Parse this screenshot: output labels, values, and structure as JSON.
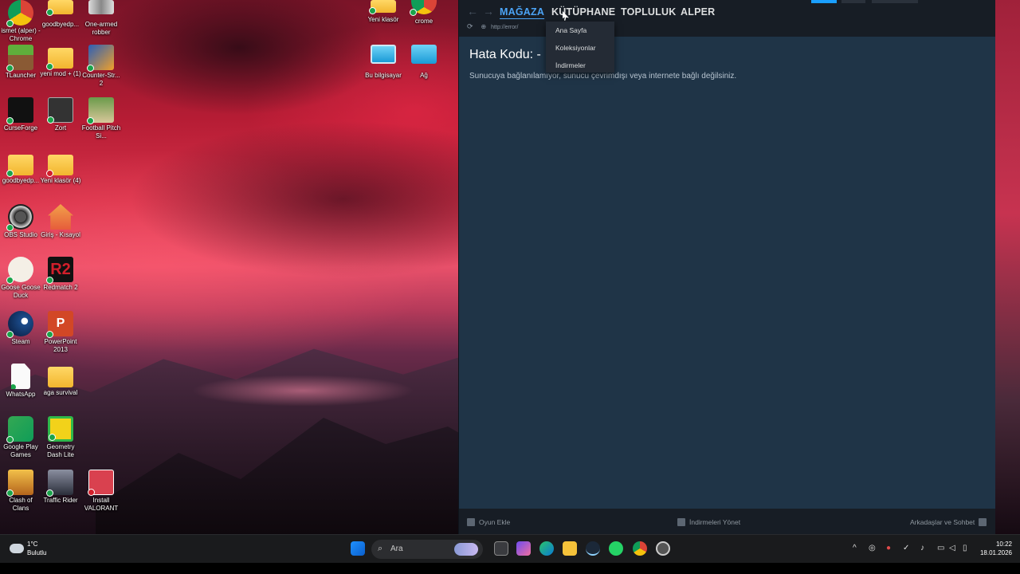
{
  "desktop_icons": [
    {
      "label": "ismet (alper) - Chrome",
      "icon": "chrome-icon",
      "badge": "ok"
    },
    {
      "label": "goodbyedp...",
      "icon": "folder-icon",
      "badge": "ok"
    },
    {
      "label": "One-armed robber",
      "icon": "game-icon",
      "badge": "none"
    },
    {
      "label": "TLauncher",
      "icon": "minecraft-icon",
      "badge": "ok"
    },
    {
      "label": "yeni mod + (1)",
      "icon": "folder-icon",
      "badge": "ok"
    },
    {
      "label": "Counter-Str... 2",
      "icon": "counter-strike-icon",
      "badge": "ok"
    },
    {
      "label": "CurseForge",
      "icon": "curseforge-icon",
      "badge": "ok"
    },
    {
      "label": "Zort",
      "icon": "zort-icon",
      "badge": "ok"
    },
    {
      "label": "Football Pitch Si...",
      "icon": "football-icon",
      "badge": "ok"
    },
    {
      "label": "goodbyedp...",
      "icon": "folder-icon",
      "badge": "ok"
    },
    {
      "label": "Yeni klasör (4)",
      "icon": "folder-icon",
      "badge": "err"
    },
    {
      "label": "OBS Studio",
      "icon": "obs-icon",
      "badge": "ok"
    },
    {
      "label": "Giriş - Kısayol",
      "icon": "home-icon",
      "badge": "ok"
    },
    {
      "label": "Goose Goose Duck",
      "icon": "goose-icon",
      "badge": "ok"
    },
    {
      "label": "Redmatch 2",
      "icon": "redmatch-icon",
      "badge": "ok"
    },
    {
      "label": "Steam",
      "icon": "steam-icon",
      "badge": "ok"
    },
    {
      "label": "PowerPoint 2013",
      "icon": "powerpoint-icon",
      "badge": "ok"
    },
    {
      "label": "WhatsApp",
      "icon": "file-icon",
      "badge": "ok"
    },
    {
      "label": "aga survival",
      "icon": "folder-icon",
      "badge": "none"
    },
    {
      "label": "Google Play Games",
      "icon": "google-play-games-icon",
      "badge": "ok"
    },
    {
      "label": "Geometry Dash Lite",
      "icon": "geometry-dash-icon",
      "badge": "ok"
    },
    {
      "label": "Clash of Clans",
      "icon": "clash-icon",
      "badge": "ok"
    },
    {
      "label": "Traffic Rider",
      "icon": "traffic-rider-icon",
      "badge": "ok"
    },
    {
      "label": "Install VALORANT",
      "icon": "valorant-icon",
      "badge": "err"
    },
    {
      "label": "Yeni klasör",
      "icon": "folder-icon",
      "badge": "ok"
    },
    {
      "label": "crome",
      "icon": "chrome-icon",
      "badge": "ok"
    },
    {
      "label": "Bu bilgisayar",
      "icon": "computer-icon",
      "badge": "none"
    },
    {
      "label": "Ağ",
      "icon": "network-icon",
      "badge": "none"
    }
  ],
  "steam": {
    "tabs": [
      "MAĞAZA",
      "KÜTÜPHANE",
      "TOPLULUK",
      "ALPER"
    ],
    "url": "http://error/",
    "error_title": "Hata Kodu: -",
    "error_message": "Sunucuya bağlanılamıyor, sunucu çevrimdışı veya internete bağlı değilsiniz.",
    "library_menu": [
      "Ana Sayfa",
      "Koleksiyonlar",
      "İndirmeler"
    ],
    "bottom": {
      "add_game": "Oyun Ekle",
      "manage_downloads": "İndirmeleri Yönet",
      "friends_chat": "Arkadaşlar ve Sohbet"
    },
    "accent": "#4ba3f5"
  },
  "taskbar": {
    "weather_temp": "1°C",
    "weather_desc": "Bulutlu",
    "search_placeholder": "Ara",
    "time": "10:22",
    "date": "18.01.2026"
  }
}
